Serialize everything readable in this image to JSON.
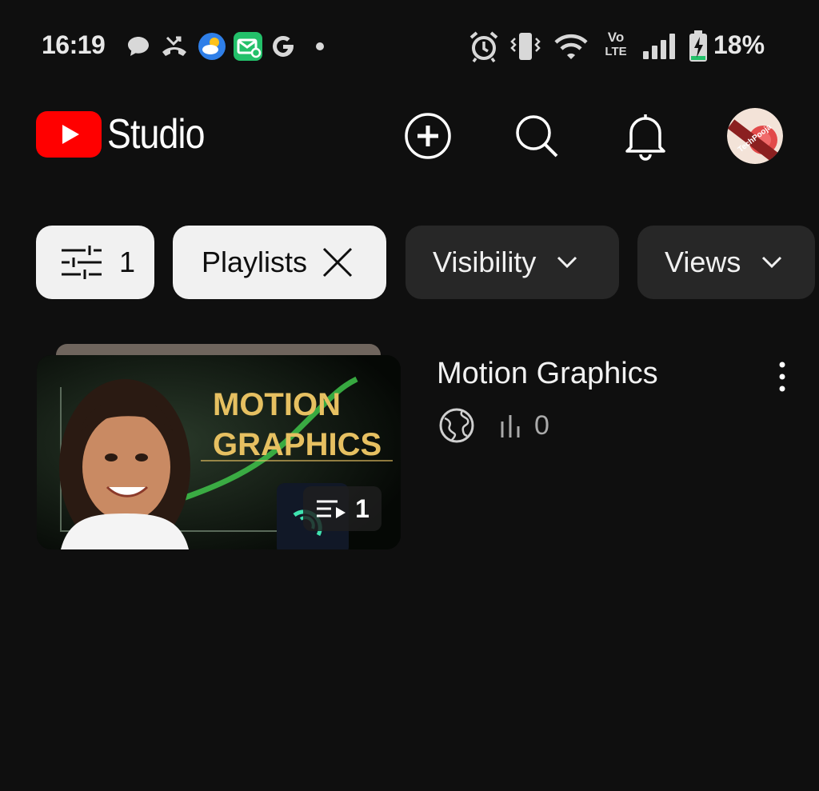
{
  "status_bar": {
    "time": "16:19",
    "battery_percent": "18%",
    "icons": [
      "chat-icon",
      "missed-call-icon",
      "weather-icon",
      "mail-icon",
      "google-icon",
      "dot-icon",
      "alarm-icon",
      "vibrate-icon",
      "wifi-icon",
      "volte-icon",
      "signal-icon",
      "battery-charging-icon"
    ],
    "volte_label_top": "Vo",
    "volte_label_bottom": "LTE"
  },
  "header": {
    "app_title": "Studio",
    "brand_color": "#ff0000",
    "actions": [
      "create-icon",
      "search-icon",
      "notifications-icon"
    ],
    "avatar_text": "TechPooja"
  },
  "filters": {
    "filter_count": "1",
    "chips": [
      {
        "label": "Playlists",
        "active": true
      },
      {
        "label": "Visibility",
        "active": false
      },
      {
        "label": "Views",
        "active": false
      }
    ]
  },
  "playlists": [
    {
      "title": "Motion Graphics",
      "visibility_icon": "globe-icon",
      "views": "0",
      "video_count": "1",
      "thumbnail_text_line1": "MOTION",
      "thumbnail_text_line2": "GRAPHICS"
    }
  ]
}
